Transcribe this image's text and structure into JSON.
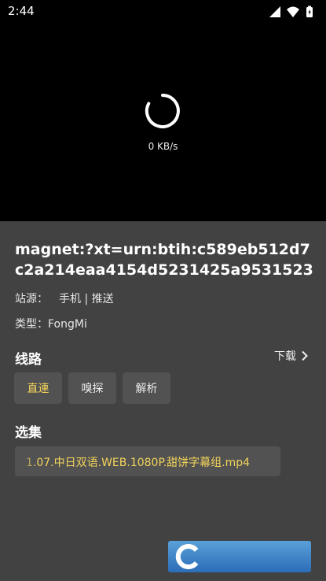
{
  "status_bar": {
    "time": "2:44"
  },
  "player": {
    "speed": "0 KB/s"
  },
  "detail": {
    "title": "magnet:?xt=urn:btih:c589eb512d7c2a214eaa4154d5231425a9531523",
    "site": "站源： 手机 | 推送",
    "type": "类型：FongMi"
  },
  "routes": {
    "title": "线路",
    "download_label": "下载",
    "buttons": [
      "直連",
      "嗅探",
      "解析"
    ],
    "active_index": 0
  },
  "episodes": {
    "title": "选集",
    "items": [
      "1.07.中日双语.WEB.1080P.甜饼字幕组.mp4"
    ]
  },
  "colors": {
    "accent": "#f3d45b",
    "panel": "#424242",
    "chip": "#525252"
  }
}
